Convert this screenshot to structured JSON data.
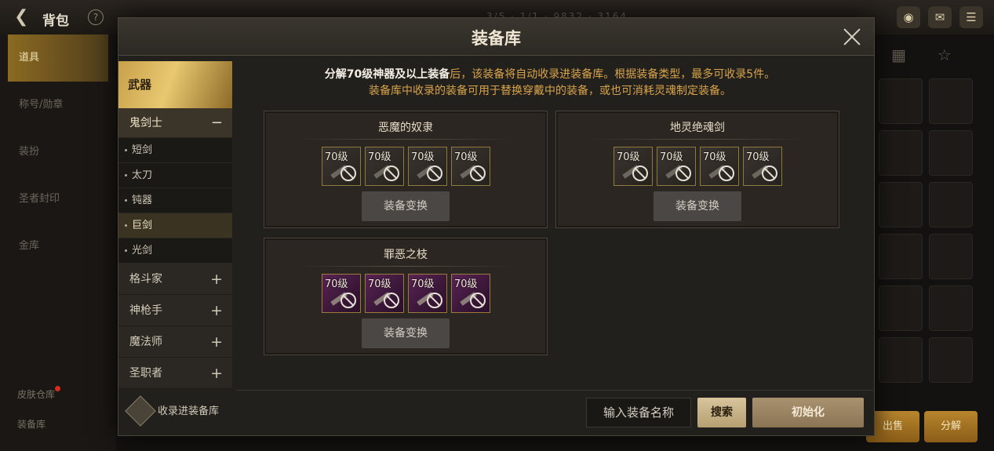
{
  "background": {
    "back_icon": "arrow-left-icon",
    "title": "背包",
    "help_label": "?",
    "ticker": "3/5  ·  1/1  ·  9832  ·  3164",
    "top_icons": [
      "coin-bag-icon",
      "mail-icon",
      "chat-icon"
    ],
    "sidebar": [
      "道具",
      "称号/勋章",
      "装扮",
      "圣者封印",
      "金库"
    ],
    "bottom_left": [
      "皮肤仓库",
      "装备库"
    ],
    "right_buttons": [
      "出售",
      "分解"
    ],
    "tab_icons": [
      "card-icon",
      "star-icon"
    ]
  },
  "modal": {
    "title": "装备库",
    "description": {
      "line1_strong": "分解70级神器及以上装备",
      "line1_rest": "后，该装备将自动收录进装备库。根据装备类型，最多可收录5件。",
      "line2": "装备库中收录的装备可用于替换穿戴中的装备，或也可消耗灵魂制定装备。"
    },
    "side": {
      "category": "武器",
      "class_open": "鬼剑士",
      "class_open_toggle": "−",
      "weapons": [
        "短剑",
        "太刀",
        "钝器",
        "巨剑",
        "光剑"
      ],
      "active_weapon_index": 3,
      "other_classes": [
        "格斗家",
        "神枪手",
        "魔法师",
        "圣职者"
      ],
      "other_toggle": "+",
      "collect_label": "收录进装备库"
    },
    "panels": [
      {
        "title": "恶魔的奴隶",
        "slots": [
          "70级",
          "70级",
          "70级",
          "70级"
        ],
        "style": "grey",
        "button": "装备变换"
      },
      {
        "title": "地灵绝魂剑",
        "slots": [
          "70级",
          "70级",
          "70级",
          "70级"
        ],
        "style": "grey",
        "button": "装备变换"
      },
      {
        "title": "罪恶之枝",
        "slots": [
          "70级",
          "70级",
          "70级",
          "70级"
        ],
        "style": "purple",
        "button": "装备变换"
      }
    ],
    "search": {
      "placeholder": "输入装备名称",
      "button": "搜索"
    },
    "reset_button": "初始化"
  }
}
